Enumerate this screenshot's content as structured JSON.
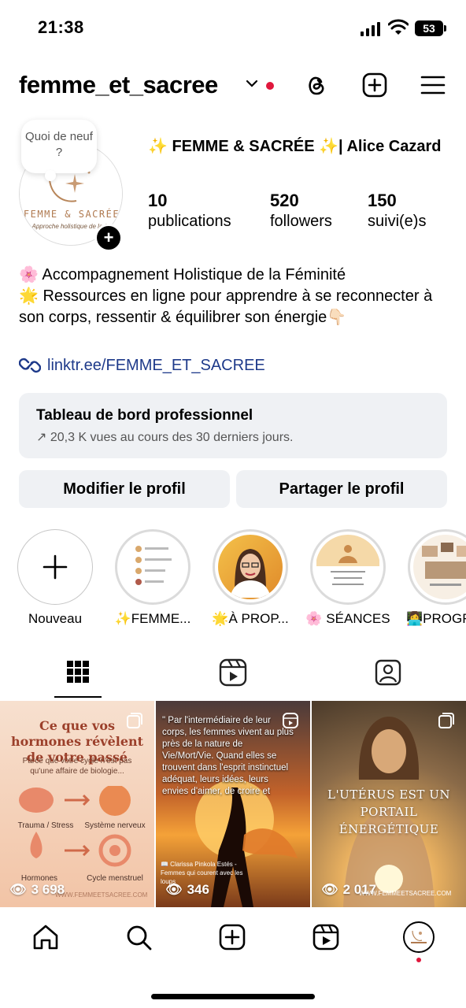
{
  "status_bar": {
    "time": "21:38",
    "battery": "53"
  },
  "header": {
    "username": "femme_et_sacree"
  },
  "profile": {
    "note": "Quoi de neuf ?",
    "avatar_brand": "FEMME & SACRÉE",
    "avatar_tagline": "Approche holistique de la f...",
    "full_name": "✨ FEMME & SACRÉE ✨| Alice Cazard",
    "stats": [
      {
        "value": "10",
        "label": "publications"
      },
      {
        "value": "520",
        "label": "followers"
      },
      {
        "value": "150",
        "label": "suivi(e)s"
      }
    ],
    "bio_line1": "🌸 Accompagnement Holistique de la Féminité",
    "bio_line2": "🌟 Ressources en ligne pour apprendre à se reconnecter à son corps, ressentir & équilibrer son énergie👇🏻",
    "link": "linktr.ee/FEMME_ET_SACREE"
  },
  "dashboard": {
    "title": "Tableau de bord professionnel",
    "subtitle": "↗ 20,3 K vues au cours des 30 derniers jours."
  },
  "buttons": {
    "edit": "Modifier le profil",
    "share": "Partager le profil"
  },
  "highlights": [
    {
      "label": "Nouveau"
    },
    {
      "label": "✨FEMME..."
    },
    {
      "label": "🌟À PROP..."
    },
    {
      "label": "🌸 SÉANCES"
    },
    {
      "label": "👩‍💻PROGR"
    }
  ],
  "posts": [
    {
      "title": "Ce que vos hormones révèlent de votre passé",
      "subtitle": "Parce que votre cycle n'est pas qu'une affaire de biologie...",
      "labels": [
        "Trauma / Stress",
        "Système nerveux",
        "Hormones",
        "Cycle menstruel"
      ],
      "views": "3 698",
      "watermark": "WWW.FEMMEETSACREE.COM"
    },
    {
      "quote": "\" Par l'intermédiaire de leur corps, les femmes vivent au plus près de la nature de Vie/Mort/Vie. Quand elles se trouvent dans l'esprit instinctuel adéquat, leurs idées, leurs envies d'aimer, de croire et",
      "source": "📖 Clarissa Pinkola Estés - Femmes qui courent avec les loups",
      "views": "346"
    },
    {
      "title": "L'UTÉRUS EST UN PORTAIL ÉNERGÉTIQUE",
      "views": "2 017",
      "watermark": "WWW.FEMMEETSACREE.COM"
    }
  ],
  "colors": {
    "accent_red": "#e0173c",
    "link_blue": "#1e3a8a",
    "button_bg": "#eff1f4"
  }
}
